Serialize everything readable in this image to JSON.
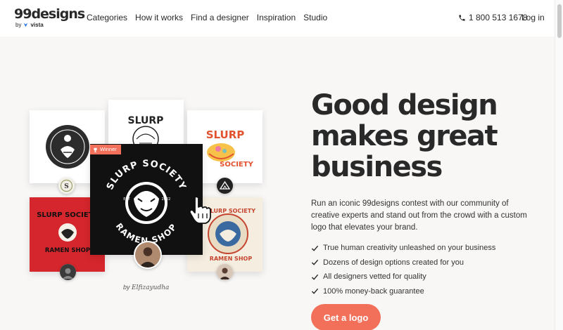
{
  "brand": {
    "name": "99designs",
    "by": "by",
    "partner": "vista"
  },
  "nav": {
    "items": [
      "Categories",
      "How it works",
      "Find a designer",
      "Inspiration",
      "Studio"
    ]
  },
  "header_right": {
    "phone": "1 800 513 1678",
    "login": "Log in"
  },
  "icons": {
    "phone": "phone-icon",
    "check": "check-icon",
    "trophy": "trophy-icon",
    "cursor": "hand-cursor-icon"
  },
  "colors": {
    "accent": "#f26f5a",
    "text": "#292929",
    "background": "#f8f7f6",
    "card_red": "#d4262c"
  },
  "collage": {
    "winner_badge": "Winner",
    "featured_logo": {
      "top_text": "SLURP SOCIETY",
      "bottom_text": "RAMEN SHOP",
      "year_left": "EST",
      "year_right": "2022"
    },
    "card_texts": {
      "slurp": "SLURP",
      "society": "SOCIETY",
      "ramen_shop": "RAMEN SHOP",
      "slurp_society": "SLURP SOCIETY"
    },
    "byline_prefix": "by",
    "byline_name": "Elfizayudha"
  },
  "hero": {
    "headline": [
      "Good design",
      "makes great",
      "business"
    ],
    "subtext": "Run an iconic 99designs contest with our community of creative experts and stand out from the crowd with a custom logo that elevates your brand.",
    "benefits": [
      "True human creativity unleashed on your business",
      "Dozens of design options created for you",
      "All designers vetted for quality",
      "100% money-back guarantee"
    ],
    "cta": "Get a logo"
  }
}
